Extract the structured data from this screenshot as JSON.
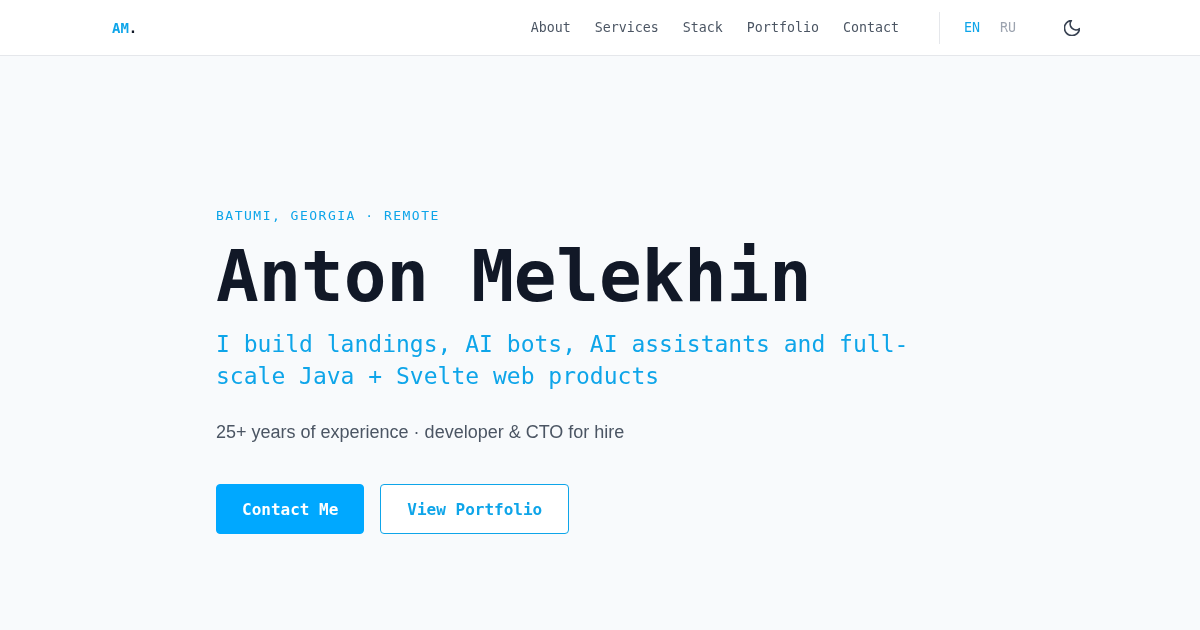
{
  "header": {
    "logo": {
      "text": "AM",
      "suffix": "."
    },
    "nav": [
      {
        "label": "About"
      },
      {
        "label": "Services"
      },
      {
        "label": "Stack"
      },
      {
        "label": "Portfolio"
      },
      {
        "label": "Contact"
      }
    ],
    "languages": [
      {
        "label": "EN",
        "selected": true
      },
      {
        "label": "RU",
        "selected": false
      }
    ]
  },
  "hero": {
    "location": "BATUMI, GEORGIA · REMOTE",
    "name": "Anton Melekhin",
    "headline": "I build landings, AI bots, AI assistants and full-scale Java + Svelte web products",
    "tagline": "25+ years of experience · developer & CTO for hire",
    "buttons": [
      {
        "label": "Contact Me",
        "kind": "primary"
      },
      {
        "label": "View Portfolio",
        "kind": "outline"
      }
    ]
  }
}
